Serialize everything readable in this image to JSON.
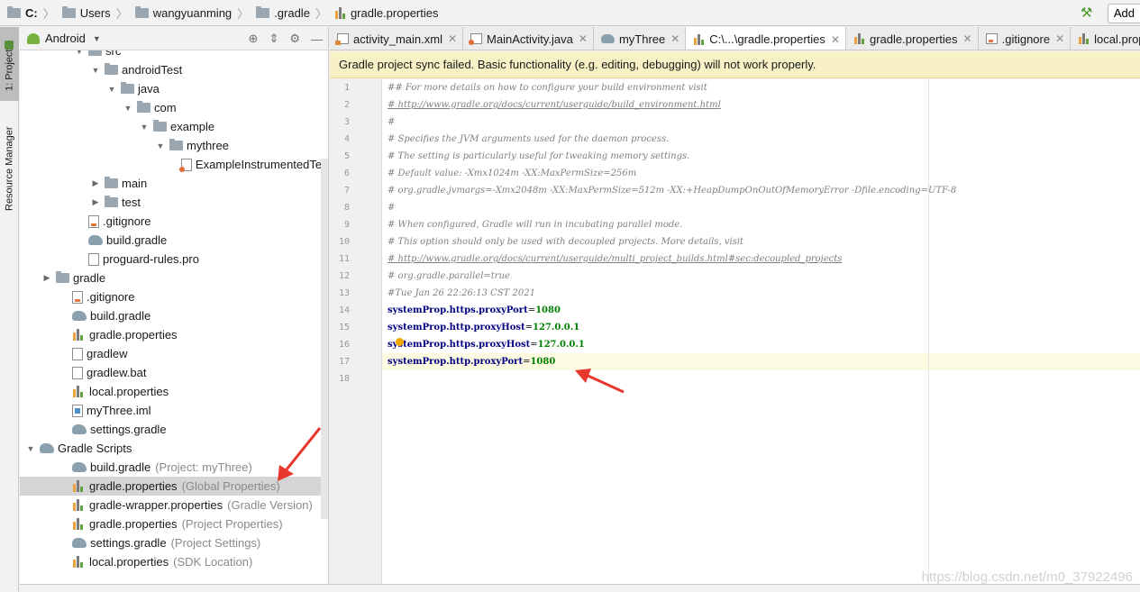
{
  "breadcrumb": [
    "C:",
    "Users",
    "wangyuanming",
    ".gradle",
    "gradle.properties"
  ],
  "toolbar": {
    "add_label": "Add"
  },
  "left_strip": {
    "project_tab": "1: Project",
    "resource_tab": "Resource Manager"
  },
  "project_panel": {
    "view_mode": "Android",
    "tree": [
      {
        "label": "src",
        "depth": 3,
        "icon": "folder",
        "expanded": true
      },
      {
        "label": "androidTest",
        "depth": 4,
        "icon": "folder",
        "expanded": true
      },
      {
        "label": "java",
        "depth": 5,
        "icon": "folder",
        "expanded": true
      },
      {
        "label": "com",
        "depth": 6,
        "icon": "folder",
        "expanded": true
      },
      {
        "label": "example",
        "depth": 7,
        "icon": "folder",
        "expanded": true
      },
      {
        "label": "mythree",
        "depth": 8,
        "icon": "folder",
        "expanded": true
      },
      {
        "label": "ExampleInstrumentedTest.java",
        "depth": 9,
        "icon": "java",
        "expanded": null
      },
      {
        "label": "main",
        "depth": 4,
        "icon": "folder",
        "expanded": false
      },
      {
        "label": "test",
        "depth": 4,
        "icon": "folder",
        "expanded": false
      },
      {
        "label": ".gitignore",
        "depth": 3,
        "icon": "git",
        "expanded": null
      },
      {
        "label": "build.gradle",
        "depth": 3,
        "icon": "gradle",
        "expanded": null
      },
      {
        "label": "proguard-rules.pro",
        "depth": 3,
        "icon": "file",
        "expanded": null
      },
      {
        "label": "gradle",
        "depth": 1,
        "icon": "folder",
        "expanded": false
      },
      {
        "label": ".gitignore",
        "depth": 2,
        "icon": "git",
        "expanded": null
      },
      {
        "label": "build.gradle",
        "depth": 2,
        "icon": "gradle",
        "expanded": null
      },
      {
        "label": "gradle.properties",
        "depth": 2,
        "icon": "props",
        "expanded": null
      },
      {
        "label": "gradlew",
        "depth": 2,
        "icon": "shell",
        "expanded": null
      },
      {
        "label": "gradlew.bat",
        "depth": 2,
        "icon": "file",
        "expanded": null
      },
      {
        "label": "local.properties",
        "depth": 2,
        "icon": "props",
        "expanded": null
      },
      {
        "label": "myThree.iml",
        "depth": 2,
        "icon": "iml",
        "expanded": null
      },
      {
        "label": "settings.gradle",
        "depth": 2,
        "icon": "gradle",
        "expanded": null
      },
      {
        "label": "Gradle Scripts",
        "depth": 0,
        "icon": "gradle",
        "expanded": true
      },
      {
        "label": "build.gradle",
        "hint": "(Project: myThree)",
        "depth": 2,
        "icon": "gradle",
        "expanded": null
      },
      {
        "label": "gradle.properties",
        "hint": "(Global Properties)",
        "depth": 2,
        "icon": "props",
        "expanded": null,
        "selected": true
      },
      {
        "label": "gradle-wrapper.properties",
        "hint": "(Gradle Version)",
        "depth": 2,
        "icon": "props",
        "expanded": null
      },
      {
        "label": "gradle.properties",
        "hint": "(Project Properties)",
        "depth": 2,
        "icon": "props",
        "expanded": null
      },
      {
        "label": "settings.gradle",
        "hint": "(Project Settings)",
        "depth": 2,
        "icon": "gradle",
        "expanded": null
      },
      {
        "label": "local.properties",
        "hint": "(SDK Location)",
        "depth": 2,
        "icon": "props",
        "expanded": null
      }
    ]
  },
  "tabs": [
    {
      "label": "activity_main.xml",
      "icon": "xml",
      "active": false
    },
    {
      "label": "MainActivity.java",
      "icon": "java",
      "active": false
    },
    {
      "label": "myThree",
      "icon": "gradle",
      "active": false
    },
    {
      "label": "C:\\...\\gradle.properties",
      "icon": "props",
      "active": true
    },
    {
      "label": "gradle.properties",
      "icon": "props",
      "active": false
    },
    {
      "label": ".gitignore",
      "icon": "git",
      "active": false
    },
    {
      "label": "local.properties",
      "icon": "props",
      "active": false
    }
  ],
  "banner": {
    "message": "Gradle project sync failed. Basic functionality (e.g. editing, debugging) will not work properly."
  },
  "editor": {
    "current_line": 17,
    "lines": [
      {
        "n": "1",
        "kind": "comment",
        "text": "## For more details on how to configure your build environment visit"
      },
      {
        "n": "2",
        "kind": "link",
        "text": "# http://www.gradle.org/docs/current/userguide/build_environment.html"
      },
      {
        "n": "3",
        "kind": "comment",
        "text": "#"
      },
      {
        "n": "4",
        "kind": "comment",
        "text": "# Specifies the JVM arguments used for the daemon process."
      },
      {
        "n": "5",
        "kind": "comment",
        "text": "# The setting is particularly useful for tweaking memory settings."
      },
      {
        "n": "6",
        "kind": "comment",
        "text": "# Default value: -Xmx1024m -XX:MaxPermSize=256m"
      },
      {
        "n": "7",
        "kind": "comment",
        "text": "# org.gradle.jvmargs=-Xmx2048m -XX:MaxPermSize=512m -XX:+HeapDumpOnOutOfMemoryError -Dfile.encoding=UTF-8"
      },
      {
        "n": "8",
        "kind": "comment",
        "text": "#"
      },
      {
        "n": "9",
        "kind": "comment",
        "text": "# When configured, Gradle will run in incubating parallel mode."
      },
      {
        "n": "10",
        "kind": "comment",
        "text": "# This option should only be used with decoupled projects. More details, visit"
      },
      {
        "n": "11",
        "kind": "link",
        "text": "# http://www.gradle.org/docs/current/userguide/multi_project_builds.html#sec:decoupled_projects"
      },
      {
        "n": "12",
        "kind": "comment",
        "text": "# org.gradle.parallel=true"
      },
      {
        "n": "13",
        "kind": "comment",
        "text": "#Tue Jan 26 22:26:13 CST 2021"
      },
      {
        "n": "14",
        "kind": "prop",
        "key": "systemProp.https.proxyPort",
        "value": "1080"
      },
      {
        "n": "15",
        "kind": "prop",
        "key": "systemProp.http.proxyHost",
        "value": "127.0.0.1"
      },
      {
        "n": "16",
        "kind": "prop",
        "key": "systemProp.https.proxyHost",
        "value": "127.0.0.1"
      },
      {
        "n": "17",
        "kind": "prop",
        "key": "systemProp.http.proxyPort",
        "value": "1080"
      },
      {
        "n": "18",
        "kind": "empty",
        "text": ""
      }
    ]
  },
  "watermark": "https://blog.csdn.net/m0_37922496",
  "colors": {
    "banner_bg": "#f8f1c5",
    "annotation_arrow": "#e8372c",
    "selection": "#d5d5d5"
  }
}
